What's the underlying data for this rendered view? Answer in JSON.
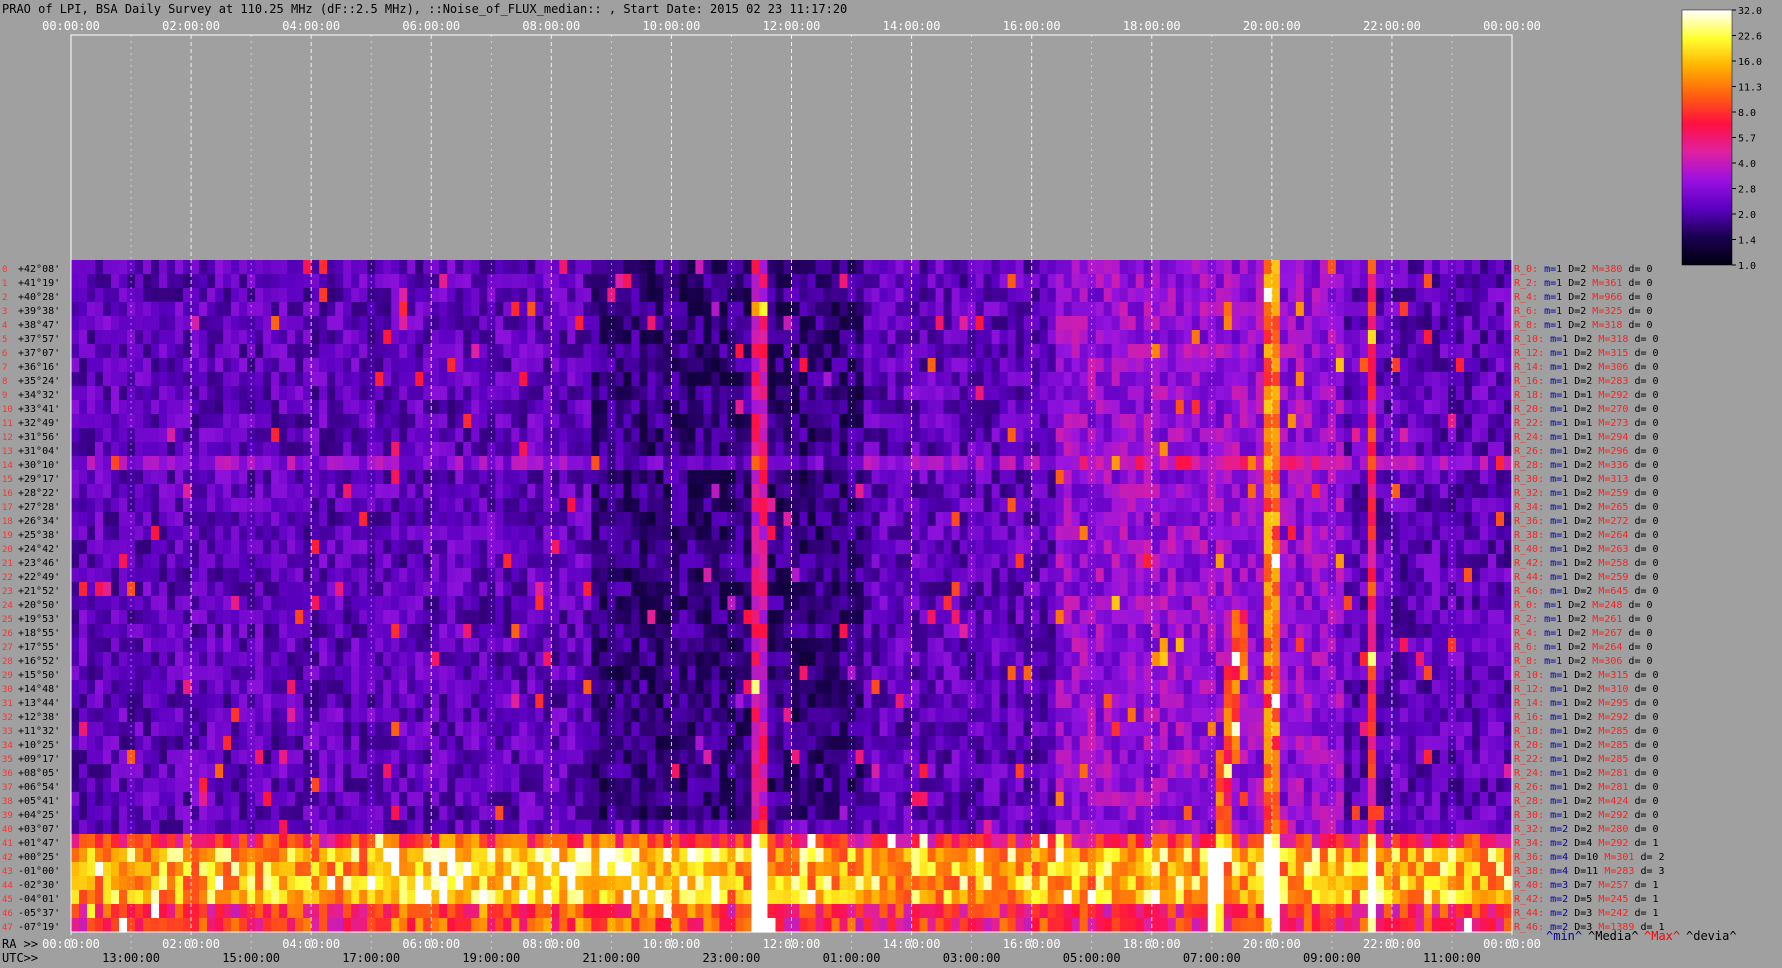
{
  "title": "PRAO of LPI, BSA Daily Survey at 110.25 MHz (dF::2.5 MHz), ::Noise_of_FLUX_median:: , Start Date: 2015 02 23 11:17:20",
  "axes": {
    "top_times": [
      "00:00:00",
      "02:00:00",
      "04:00:00",
      "06:00:00",
      "08:00:00",
      "10:00:00",
      "12:00:00",
      "14:00:00",
      "16:00:00",
      "18:00:00",
      "20:00:00",
      "22:00:00",
      "00:00:00"
    ],
    "bottom_ra_label": "RA >>",
    "bottom_ra": [
      "00:00:00",
      "02:00:00",
      "04:00:00",
      "06:00:00",
      "08:00:00",
      "10:00:00",
      "12:00:00",
      "14:00:00",
      "16:00:00",
      "18:00:00",
      "20:00:00",
      "22:00:00",
      "00:00:00"
    ],
    "bottom_utc_label": "UTC>>",
    "bottom_utc": [
      "13:00:00",
      "15:00:00",
      "17:00:00",
      "19:00:00",
      "21:00:00",
      "23:00:00",
      "01:00:00",
      "03:00:00",
      "05:00:00",
      "07:00:00",
      "09:00:00",
      "11:00:00"
    ]
  },
  "colorbar": {
    "ticks": [
      "32.0",
      "22.6",
      "16.0",
      "11.3",
      "8.0",
      "5.7",
      "4.0",
      "2.8",
      "2.0",
      "1.4",
      "1.0"
    ],
    "colors": [
      "#000010",
      "#1a0050",
      "#5a00c0",
      "#9a10e0",
      "#e020a0",
      "#ff1040",
      "#ff6010",
      "#ffb000",
      "#ffff30",
      "#ffffff"
    ]
  },
  "legend_keys": [
    {
      "text": "^min^",
      "color": "#0000a0"
    },
    {
      "text": "^Media^",
      "color": "#000000"
    },
    {
      "text": "^Max^",
      "color": "#ff0000"
    },
    {
      "text": "^devia^",
      "color": "#000000"
    }
  ],
  "chart_data": {
    "type": "heatmap",
    "title": "PRAO of LPI, BSA Daily Survey at 110.25 MHz (dF::2.5 MHz), ::Noise_of_FLUX_median:: , Start Date: 2015 02 23 11:17:20",
    "declinations": [
      "+42°08'",
      "+41°19'",
      "+40°28'",
      "+39°38'",
      "+38°47'",
      "+37°57'",
      "+37°07'",
      "+36°16'",
      "+35°24'",
      "+34°32'",
      "+33°41'",
      "+32°49'",
      "+31°56'",
      "+31°04'",
      "+30°10'",
      "+29°17'",
      "+28°22'",
      "+27°28'",
      "+26°34'",
      "+25°38'",
      "+24°42'",
      "+23°46'",
      "+22°49'",
      "+21°52'",
      "+20°50'",
      "+19°53'",
      "+18°55'",
      "+17°55'",
      "+16°52'",
      "+15°50'",
      "+14°48'",
      "+13°44'",
      "+12°38'",
      "+11°32'",
      "+10°25'",
      "+09°17'",
      "+08°05'",
      "+06°54'",
      "+05°41'",
      "+04°25'",
      "+03°07'",
      "+01°47'",
      "+00°25'",
      "-01°00'",
      "-02°30'",
      "-04°01'",
      "-05°37'",
      "-07°19'"
    ],
    "rows": [
      {
        "r": "R_0:",
        "m": "m=1",
        "D": "D=2",
        "M": "M=380",
        "d": "d= 0"
      },
      {
        "r": "R_2:",
        "m": "m=1",
        "D": "D=2",
        "M": "M=361",
        "d": "d= 0"
      },
      {
        "r": "R_4:",
        "m": "m=1",
        "D": "D=2",
        "M": "M=966",
        "d": "d= 0"
      },
      {
        "r": "R_6:",
        "m": "m=1",
        "D": "D=2",
        "M": "M=325",
        "d": "d= 0"
      },
      {
        "r": "R_8:",
        "m": "m=1",
        "D": "D=2",
        "M": "M=318",
        "d": "d= 0"
      },
      {
        "r": "R_10:",
        "m": "m=1",
        "D": "D=2",
        "M": "M=318",
        "d": "d= 0"
      },
      {
        "r": "R_12:",
        "m": "m=1",
        "D": "D=2",
        "M": "M=315",
        "d": "d= 0"
      },
      {
        "r": "R_14:",
        "m": "m=1",
        "D": "D=2",
        "M": "M=306",
        "d": "d= 0"
      },
      {
        "r": "R_16:",
        "m": "m=1",
        "D": "D=2",
        "M": "M=283",
        "d": "d= 0"
      },
      {
        "r": "R_18:",
        "m": "m=1",
        "D": "D=1",
        "M": "M=292",
        "d": "d= 0"
      },
      {
        "r": "R_20:",
        "m": "m=1",
        "D": "D=2",
        "M": "M=270",
        "d": "d= 0"
      },
      {
        "r": "R_22:",
        "m": "m=1",
        "D": "D=1",
        "M": "M=273",
        "d": "d= 0"
      },
      {
        "r": "R_24:",
        "m": "m=1",
        "D": "D=1",
        "M": "M=294",
        "d": "d= 0"
      },
      {
        "r": "R_26:",
        "m": "m=1",
        "D": "D=2",
        "M": "M=296",
        "d": "d= 0"
      },
      {
        "r": "R_28:",
        "m": "m=1",
        "D": "D=2",
        "M": "M=336",
        "d": "d= 0"
      },
      {
        "r": "R_30:",
        "m": "m=1",
        "D": "D=2",
        "M": "M=313",
        "d": "d= 0"
      },
      {
        "r": "R_32:",
        "m": "m=1",
        "D": "D=2",
        "M": "M=259",
        "d": "d= 0"
      },
      {
        "r": "R_34:",
        "m": "m=1",
        "D": "D=2",
        "M": "M=265",
        "d": "d= 0"
      },
      {
        "r": "R_36:",
        "m": "m=1",
        "D": "D=2",
        "M": "M=272",
        "d": "d= 0"
      },
      {
        "r": "R_38:",
        "m": "m=1",
        "D": "D=2",
        "M": "M=264",
        "d": "d= 0"
      },
      {
        "r": "R_40:",
        "m": "m=1",
        "D": "D=2",
        "M": "M=263",
        "d": "d= 0"
      },
      {
        "r": "R_42:",
        "m": "m=1",
        "D": "D=2",
        "M": "M=258",
        "d": "d= 0"
      },
      {
        "r": "R_44:",
        "m": "m=1",
        "D": "D=2",
        "M": "M=259",
        "d": "d= 0"
      },
      {
        "r": "R_46:",
        "m": "m=1",
        "D": "D=2",
        "M": "M=645",
        "d": "d= 0"
      },
      {
        "r": "R_0:",
        "m": "m=1",
        "D": "D=2",
        "M": "M=248",
        "d": "d= 0"
      },
      {
        "r": "R_2:",
        "m": "m=1",
        "D": "D=2",
        "M": "M=261",
        "d": "d= 0"
      },
      {
        "r": "R_4:",
        "m": "m=1",
        "D": "D=2",
        "M": "M=267",
        "d": "d= 0"
      },
      {
        "r": "R_6:",
        "m": "m=1",
        "D": "D=2",
        "M": "M=264",
        "d": "d= 0"
      },
      {
        "r": "R_8:",
        "m": "m=1",
        "D": "D=2",
        "M": "M=306",
        "d": "d= 0"
      },
      {
        "r": "R_10:",
        "m": "m=1",
        "D": "D=2",
        "M": "M=315",
        "d": "d= 0"
      },
      {
        "r": "R_12:",
        "m": "m=1",
        "D": "D=2",
        "M": "M=310",
        "d": "d= 0"
      },
      {
        "r": "R_14:",
        "m": "m=1",
        "D": "D=2",
        "M": "M=295",
        "d": "d= 0"
      },
      {
        "r": "R_16:",
        "m": "m=1",
        "D": "D=2",
        "M": "M=292",
        "d": "d= 0"
      },
      {
        "r": "R_18:",
        "m": "m=1",
        "D": "D=2",
        "M": "M=285",
        "d": "d= 0"
      },
      {
        "r": "R_20:",
        "m": "m=1",
        "D": "D=2",
        "M": "M=285",
        "d": "d= 0"
      },
      {
        "r": "R_22:",
        "m": "m=1",
        "D": "D=2",
        "M": "M=285",
        "d": "d= 0"
      },
      {
        "r": "R_24:",
        "m": "m=1",
        "D": "D=2",
        "M": "M=281",
        "d": "d= 0"
      },
      {
        "r": "R_26:",
        "m": "m=1",
        "D": "D=2",
        "M": "M=281",
        "d": "d= 0"
      },
      {
        "r": "R_28:",
        "m": "m=1",
        "D": "D=2",
        "M": "M=424",
        "d": "d= 0"
      },
      {
        "r": "R_30:",
        "m": "m=1",
        "D": "D=2",
        "M": "M=292",
        "d": "d= 0"
      },
      {
        "r": "R_32:",
        "m": "m=2",
        "D": "D=2",
        "M": "M=280",
        "d": "d= 0"
      },
      {
        "r": "R_34:",
        "m": "m=2",
        "D": "D=4",
        "M": "M=292",
        "d": "d= 1"
      },
      {
        "r": "R_36:",
        "m": "m=4",
        "D": "D=10",
        "M": "M=301",
        "d": "d= 2"
      },
      {
        "r": "R_38:",
        "m": "m=4",
        "D": "D=11",
        "M": "M=283",
        "d": "d= 3"
      },
      {
        "r": "R_40:",
        "m": "m=3",
        "D": "D=7",
        "M": "M=257",
        "d": "d= 1"
      },
      {
        "r": "R_42:",
        "m": "m=2",
        "D": "D=5",
        "M": "M=245",
        "d": "d= 1"
      },
      {
        "r": "R_44:",
        "m": "m=2",
        "D": "D=3",
        "M": "M=242",
        "d": "d= 1"
      },
      {
        "r": "R_46:",
        "m": "m=2",
        "D": "D=3",
        "M": "M=1389",
        "d": "d= 1"
      }
    ],
    "features": {
      "bright_band_rows": [
        41,
        42,
        43,
        44,
        45,
        46,
        47
      ],
      "bright_columns_fraction": [
        0.475,
        0.83,
        0.9
      ],
      "diagonal_streak": {
        "from": [
          0.79,
          47
        ],
        "to": [
          0.83,
          0
        ]
      }
    }
  }
}
